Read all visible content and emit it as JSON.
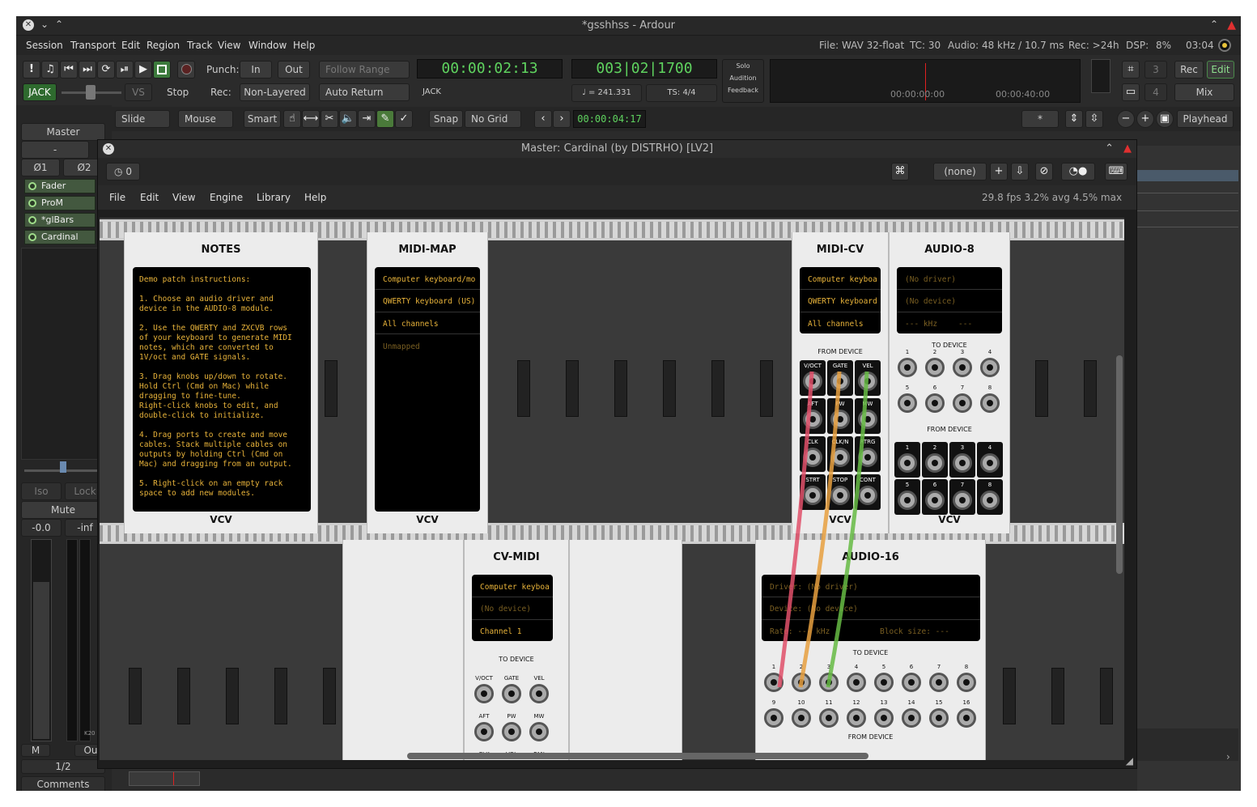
{
  "window": {
    "title": "*gsshhss - Ardour"
  },
  "menu": [
    "Session",
    "Transport",
    "Edit",
    "Region",
    "Track",
    "View",
    "Window",
    "Help"
  ],
  "status": {
    "file": "File: WAV 32-float",
    "tc": "TC: 30",
    "audio": "Audio: 48 kHz / 10.7 ms",
    "rec": "Rec: >24h",
    "dsp_label": "DSP:",
    "dsp": "8%",
    "time": "03:04"
  },
  "transport": {
    "punch": "Punch:",
    "in": "In",
    "out": "Out",
    "rec": "Rec:",
    "nonlayered": "Non-Layered",
    "follow": "Follow Range",
    "autoreturn": "Auto Return",
    "jack": "JACK",
    "vs": "VS",
    "stop": "Stop",
    "clock1": "00:00:02:13",
    "clock1_sub": "JACK",
    "clock2": "003|02|1700",
    "tempo": "= 241.331",
    "ts": "TS: 4/4",
    "solo": "Solo",
    "audition": "Audition",
    "feedback": "Feedback",
    "tl1": "00:00:00:00",
    "tl2": "00:00:40:00",
    "n3": "3",
    "n4": "4",
    "rec_btn": "Rec",
    "edit_btn": "Edit",
    "mix_btn": "Mix"
  },
  "edittools": {
    "slide": "Slide",
    "mouse": "Mouse",
    "smart": "Smart",
    "snap": "Snap",
    "grid": "No Grid",
    "clock": "00:00:04:17",
    "star": "*",
    "playhead": "Playhead"
  },
  "strip": {
    "name": "Master",
    "dash": "-",
    "o1": "Ø1",
    "o2": "Ø2",
    "plugins": [
      "Fader",
      "ProM",
      "*glBars",
      "Cardinal"
    ],
    "iso": "Iso",
    "lock": "Lock",
    "mute": "Mute",
    "gain": "-0.0",
    "peak": "-inf",
    "m": "M",
    "ou": "Ou",
    "ratio": "1/2",
    "comments": "Comments",
    "k20": "K20"
  },
  "plugin": {
    "title": "Master: Cardinal (by DISTRHO) [LV2]",
    "counter": "0",
    "preset": "(none)",
    "menu": [
      "File",
      "Edit",
      "View",
      "Engine",
      "Library",
      "Help"
    ],
    "stats": "29.8 fps  3.2% avg  4.5% max"
  },
  "modules": {
    "notes": {
      "title": "NOTES",
      "brand": "VCV",
      "text": [
        "Demo patch instructions:",
        "",
        "1. Choose an audio driver and",
        "device in the AUDIO-8 module.",
        "",
        "2. Use the QWERTY and ZXCVB rows",
        "of your keyboard to generate MIDI",
        "notes, which are converted to",
        "1V/oct and GATE signals.",
        "",
        "3. Drag knobs up/down to rotate.",
        "Hold Ctrl (Cmd on Mac) while",
        "dragging to fine-tune.",
        "Right-click knobs to edit, and",
        "double-click to initialize.",
        "",
        "4. Drag ports to create and move",
        "cables. Stack multiple cables on",
        "outputs by holding Ctrl (Cmd on",
        "Mac) and dragging from an output.",
        "",
        "5. Right-click on an empty rack",
        "space to add new modules."
      ]
    },
    "midimap": {
      "title": "MIDI-MAP",
      "brand": "VCV",
      "lines": [
        "Computer keyboard/mo",
        "QWERTY keyboard (US)",
        "All channels",
        "Unmapped"
      ]
    },
    "midicv": {
      "title": "MIDI-CV",
      "brand": "VCV",
      "lines": [
        "Computer keyboa",
        "QWERTY keyboard",
        "All channels"
      ],
      "section": "FROM DEVICE",
      "ports": [
        "V/OCT",
        "GATE",
        "VEL",
        "AFT",
        "PW",
        "MW",
        "CLK",
        "CLK/N",
        "RTRG",
        "STRT",
        "STOP",
        "CONT"
      ]
    },
    "audio8": {
      "title": "AUDIO-8",
      "brand": "VCV",
      "lines": [
        "(No driver)",
        "(No device)",
        "--- kHz",
        "---"
      ],
      "to": "TO DEVICE",
      "from": "FROM DEVICE",
      "nums": [
        "1",
        "2",
        "3",
        "4",
        "5",
        "6",
        "7",
        "8"
      ]
    },
    "cvmidi": {
      "title": "CV-MIDI",
      "lines": [
        "Computer keyboa",
        "(No device)",
        "Channel 1"
      ],
      "to": "TO DEVICE",
      "ports": [
        "V/OCT",
        "GATE",
        "VEL",
        "AFT",
        "PW",
        "MW",
        "CLK",
        "VOL",
        "PAN"
      ]
    },
    "audio16": {
      "title": "AUDIO-16",
      "driver": "Driver: (No driver)",
      "device": "Device: (No device)",
      "rate": "Rate: --- kHz",
      "block": "Block size: ---",
      "to": "TO DEVICE",
      "from": "FROM DEVICE",
      "nums": [
        "1",
        "2",
        "3",
        "4",
        "5",
        "6",
        "7",
        "8",
        "9",
        "10",
        "11",
        "12",
        "13",
        "14",
        "15",
        "16"
      ]
    }
  },
  "colors": {
    "accent": "#5fd35f",
    "cable_red": "#e0506a",
    "cable_orange": "#e8a040",
    "cable_green": "#66bb44"
  }
}
